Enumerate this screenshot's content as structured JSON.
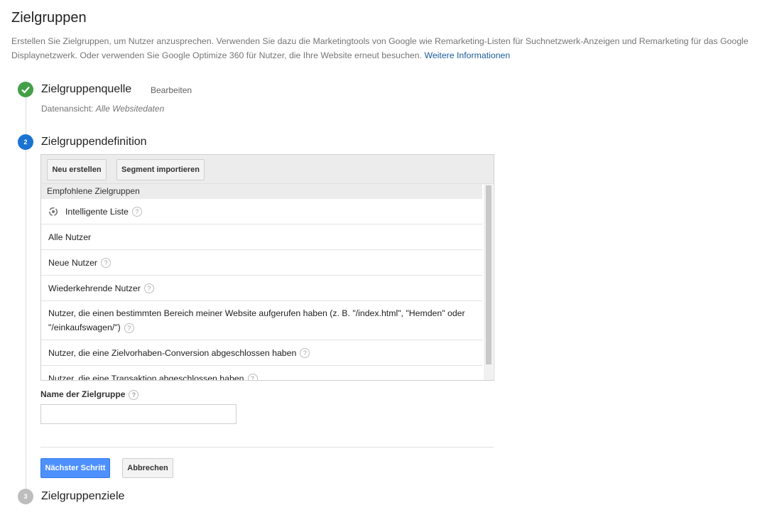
{
  "page": {
    "title": "Zielgruppen",
    "intro": "Erstellen Sie Zielgruppen, um Nutzer anzusprechen. Verwenden Sie dazu die Marketingtools von Google wie Remarketing-Listen für Suchnetzwerk-Anzeigen und Remarketing für das Google Displaynetzwerk. Oder verwenden Sie Google Optimize 360 für Nutzer, die Ihre Website erneut besuchen.",
    "more_info_link": "Weitere Informationen"
  },
  "steps": {
    "source": {
      "title": "Zielgruppenquelle",
      "edit_label": "Bearbeiten",
      "data_view_label": "Datenansicht:",
      "data_view_value": "Alle Websitedaten",
      "state_color": "#43a047"
    },
    "definition": {
      "number": "2",
      "title": "Zielgruppendefinition",
      "state_color": "#1a73d0",
      "new_button": "Neu erstellen",
      "import_button": "Segment importieren",
      "list_header": "Empfohlene Zielgruppen",
      "segments": [
        {
          "label": "Intelligente Liste",
          "icon": "smart-list-icon",
          "help": true
        },
        {
          "label": "Alle Nutzer",
          "help": false
        },
        {
          "label": "Neue Nutzer",
          "help": true
        },
        {
          "label": "Wiederkehrende Nutzer",
          "help": true
        },
        {
          "label": "Nutzer, die einen bestimmten Bereich meiner Website aufgerufen haben (z. B. \"/index.html\", \"Hemden\" oder \"/einkaufswagen/\")",
          "help": true
        },
        {
          "label": "Nutzer, die eine Zielvorhaben-Conversion abgeschlossen haben",
          "help": true
        },
        {
          "label": "Nutzer, die eine Transaktion abgeschlossen haben",
          "help": true
        }
      ],
      "name_label": "Name der Zielgruppe",
      "name_value": "",
      "next_button": "Nächster Schritt",
      "cancel_button": "Abbrechen",
      "next_button_color": "#4d90fe"
    },
    "goals": {
      "number": "3",
      "title": "Zielgruppenziele",
      "state_color": "#bdbdbd"
    }
  }
}
